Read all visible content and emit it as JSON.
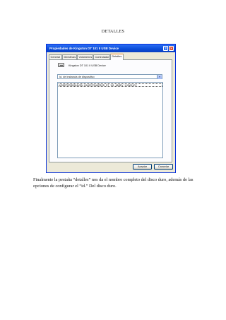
{
  "page": {
    "heading": "DETALLES",
    "caption": "Finalmente la pestaña “detalles” nos da el nombre completo del disco duro, además de las opciones de configurar el “id.” Del disco duro."
  },
  "dialog": {
    "title": "Propiedades de Kingston DT 101 II USB Device",
    "help_label": "?",
    "close_label": "×",
    "tabs": [
      {
        "label": "General",
        "active": false
      },
      {
        "label": "Directivas",
        "active": false
      },
      {
        "label": "Volúmenes",
        "active": false
      },
      {
        "label": "Controlador",
        "active": false
      },
      {
        "label": "Detalles",
        "active": true
      }
    ],
    "device_name": "Kingston DT 101 II USB Device",
    "property_select": {
      "selected": "Id. de instancia de dispositivo"
    },
    "values": [
      "USBSTOR\\DISK&VEN_KINGSTON&PROD_DT_101_II&REV_1.00\\001CC"
    ],
    "buttons": {
      "ok": "Aceptar",
      "cancel": "Cancelar"
    }
  },
  "colors": {
    "titlebar": "#0a4bd8",
    "dialog_face": "#ece9d8",
    "active_tab_accent": "#e68b2c"
  },
  "icons": {
    "device": "usb-drive-icon",
    "help": "help-icon",
    "close": "close-icon",
    "dropdown": "chevron-down-icon"
  }
}
